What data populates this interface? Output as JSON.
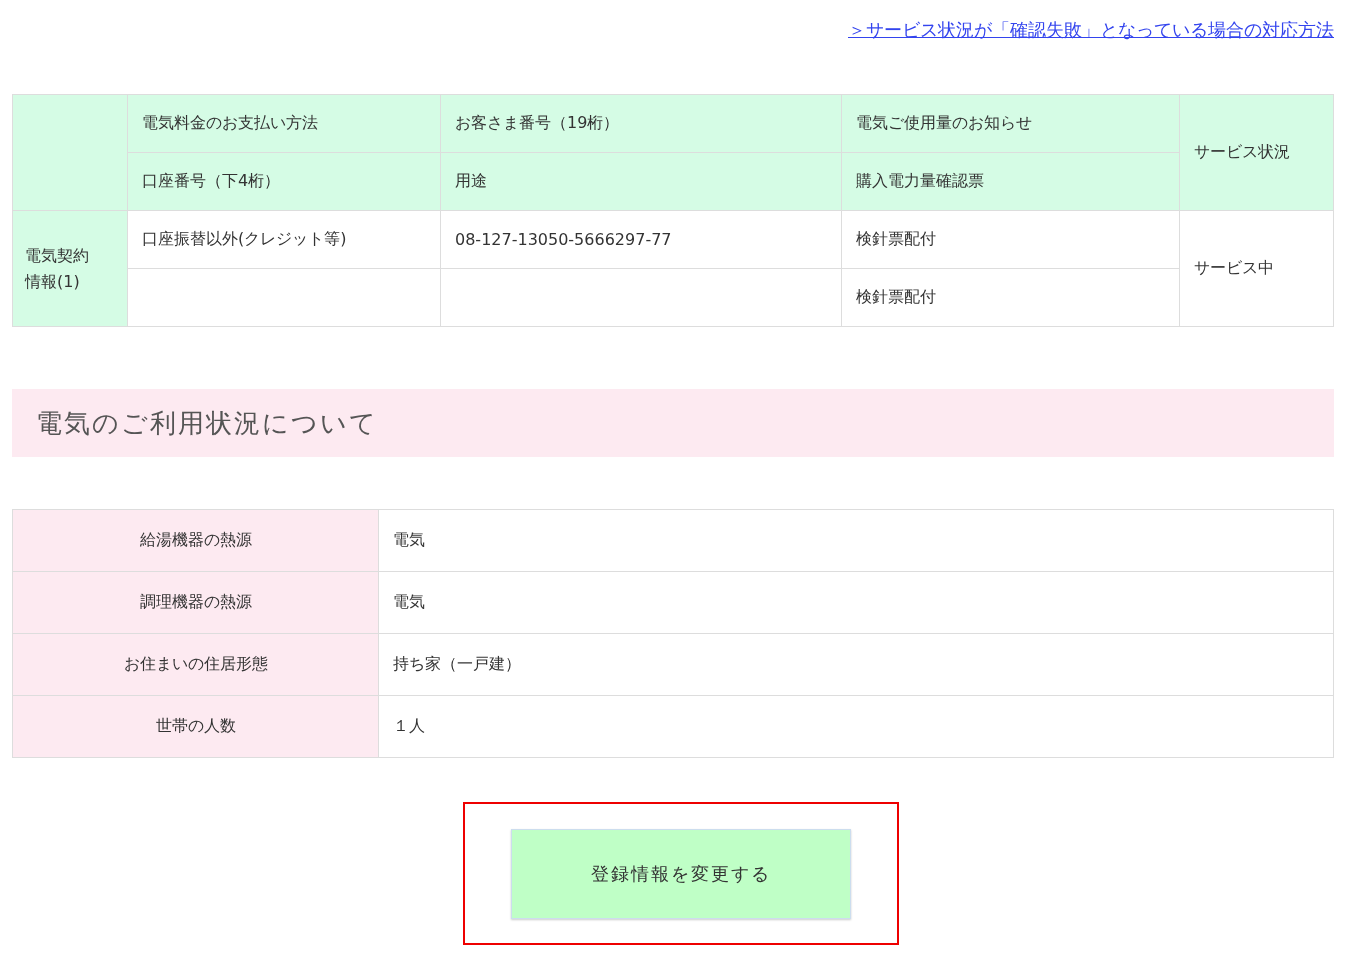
{
  "help_link": "＞サービス状況が「確認失敗」となっている場合の対応方法",
  "contract_table": {
    "header_row_1": [
      "電気料金のお支払い方法",
      "お客さま番号（19桁）",
      "電気ご使用量のお知らせ"
    ],
    "header_row_2": [
      "口座番号（下4桁）",
      "用途",
      "購入電力量確認票"
    ],
    "status_header": "サービス状況",
    "row_header": "電気契約情報(1)",
    "body_row_1": [
      "口座振替以外(クレジット等)",
      "08-127-13050-5666297-77",
      "検針票配付"
    ],
    "body_row_2_notice": "検針票配付",
    "status": "サービス中"
  },
  "usage_section": {
    "title": "電気のご利用状況について",
    "rows": [
      {
        "label": "給湯機器の熱源",
        "value": "電気"
      },
      {
        "label": "調理機器の熱源",
        "value": "電気"
      },
      {
        "label": "お住まいの住居形態",
        "value": "持ち家（一戸建）"
      },
      {
        "label": "世帯の人数",
        "value": "１人"
      }
    ]
  },
  "change_button": "登録情報を変更する"
}
